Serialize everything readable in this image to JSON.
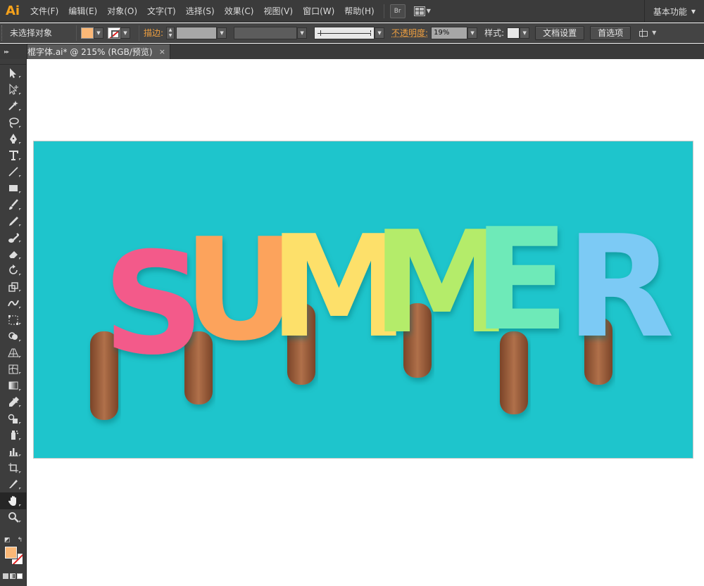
{
  "app": {
    "logo": "Ai",
    "menu": [
      "文件(F)",
      "编辑(E)",
      "对象(O)",
      "文字(T)",
      "选择(S)",
      "效果(C)",
      "视图(V)",
      "窗口(W)",
      "帮助(H)"
    ],
    "bridge_button": "Br",
    "workspace": "基本功能"
  },
  "control_bar": {
    "selection_label": "未选择对象",
    "fill_color": "#fbb877",
    "stroke_label": "描边:",
    "opacity_label": "不透明度:",
    "opacity_value": "19%",
    "style_label": "样式:",
    "document_setup": "文档设置",
    "preferences": "首选项"
  },
  "document": {
    "tab_title": "冰棍字体.ai* @ 215% (RGB/预览)",
    "close_glyph": "×"
  },
  "tools": [
    "selection-tool",
    "direct-selection-tool",
    "magic-wand-tool",
    "lasso-tool",
    "pen-tool",
    "type-tool",
    "line-segment-tool",
    "rectangle-tool",
    "paintbrush-tool",
    "pencil-tool",
    "blob-brush-tool",
    "eraser-tool",
    "rotate-tool",
    "scale-tool",
    "width-tool",
    "free-transform-tool",
    "shape-builder-tool",
    "perspective-grid-tool",
    "mesh-tool",
    "gradient-tool",
    "eyedropper-tool",
    "blend-tool",
    "symbol-sprayer-tool",
    "column-graph-tool",
    "artboard-tool",
    "slice-tool",
    "hand-tool",
    "zoom-tool"
  ],
  "active_tool": "hand-tool",
  "artwork": {
    "background_color": "#1ec5cc",
    "word": "SUMMER",
    "letters": [
      {
        "char": "S",
        "color": "#f35a8a"
      },
      {
        "char": "U",
        "color": "#fca35c"
      },
      {
        "char": "M",
        "color": "#fde06a"
      },
      {
        "char": "M",
        "color": "#b4ec6a"
      },
      {
        "char": "E",
        "color": "#6eeab8"
      },
      {
        "char": "R",
        "color": "#7ccaf5"
      }
    ],
    "stick_color": "#9a5c3c"
  }
}
